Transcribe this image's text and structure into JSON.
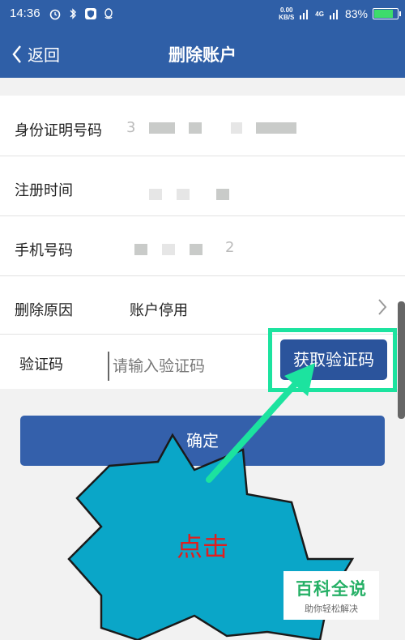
{
  "status_bar": {
    "time": "14:36",
    "net_speed_value": "0.00",
    "net_speed_unit": "KB/S",
    "signal_label": "4G",
    "battery": "83%",
    "battery_level": 0.83
  },
  "header": {
    "back_label": "返回",
    "title": "删除账户"
  },
  "form": {
    "rows": [
      {
        "label": "身份证明号码",
        "value": "3"
      },
      {
        "label": "注册时间",
        "value": ""
      },
      {
        "label": "手机号码",
        "value": "2"
      },
      {
        "label": "删除原因",
        "value": "账户停用"
      }
    ],
    "code_label": "验证码",
    "code_placeholder": "请输入验证码",
    "get_code_button": "获取验证码"
  },
  "confirm_button": "确定",
  "annotation": {
    "text": "点击",
    "highlight_color": "#1ce39f"
  },
  "watermark": {
    "title": "百科全说",
    "subtitle": "助你轻松解决"
  },
  "colors": {
    "primary": "#2f5fa7",
    "button": "#3460ab",
    "burst": "#0aa6c8",
    "annotation_text": "#e21e1e"
  }
}
